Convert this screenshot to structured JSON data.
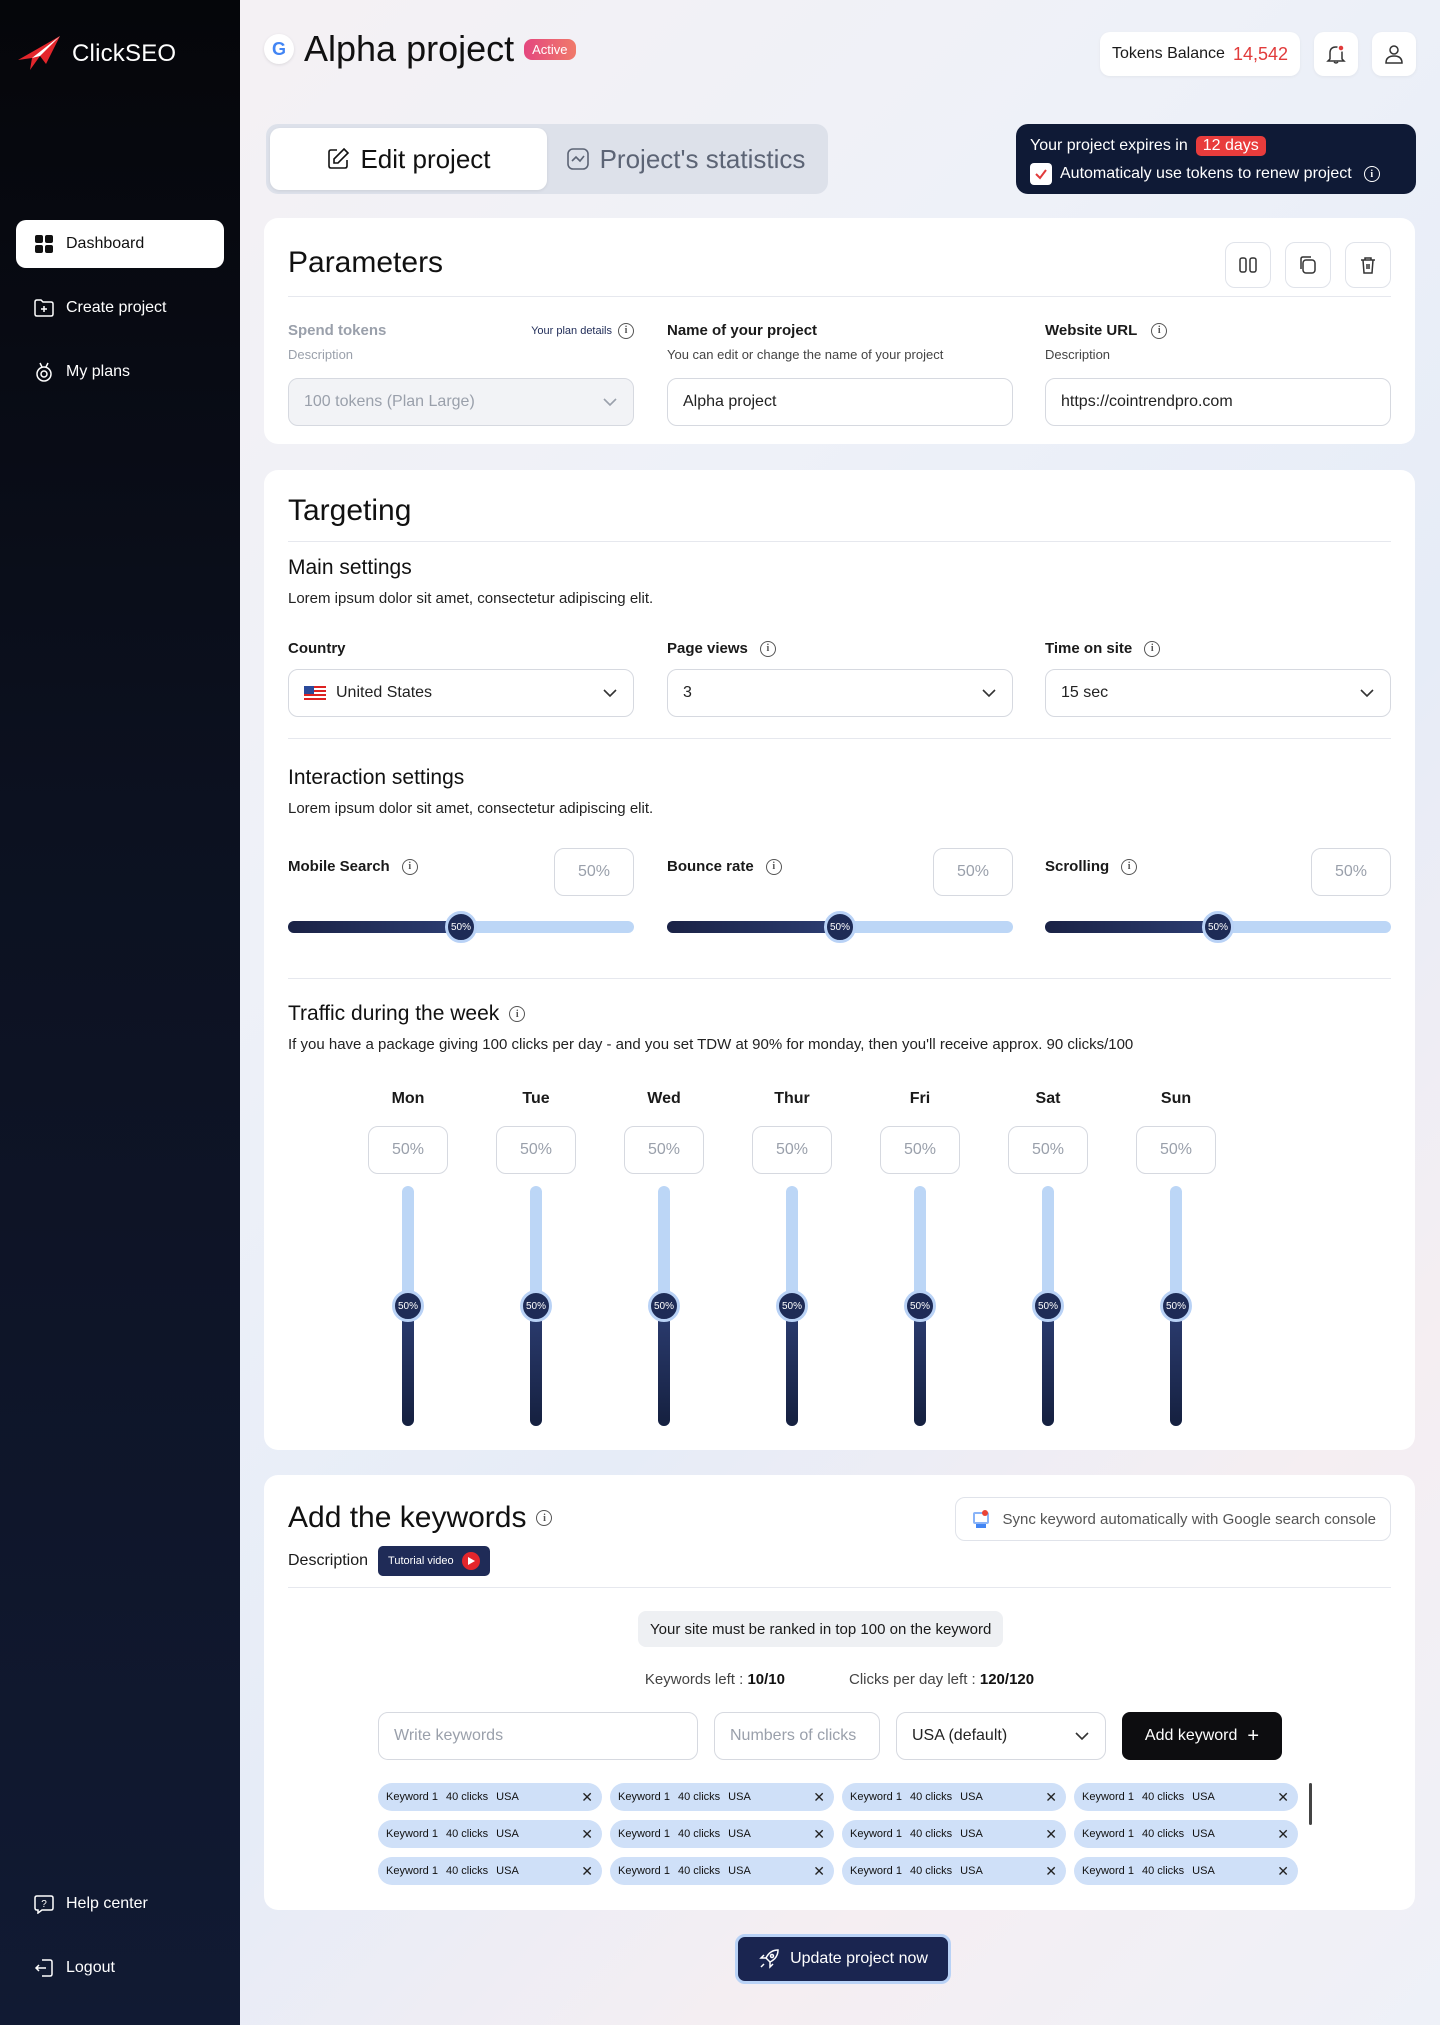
{
  "brand": {
    "name": "ClickSEO"
  },
  "sidebar": {
    "items": [
      {
        "label": "Dashboard",
        "icon": "grid-icon",
        "active": true
      },
      {
        "label": "Create project",
        "icon": "folder-plus-icon"
      },
      {
        "label": "My plans",
        "icon": "plans-icon"
      }
    ],
    "bottom": [
      {
        "label": "Help center",
        "icon": "help-icon"
      },
      {
        "label": "Logout",
        "icon": "logout-icon"
      }
    ]
  },
  "header": {
    "project_title": "Alpha project",
    "status": "Active",
    "tokens_label": "Tokens Balance",
    "tokens_value": "14,542"
  },
  "tabs": [
    {
      "label": "Edit project",
      "active": true
    },
    {
      "label": "Project's statistics"
    }
  ],
  "expiry": {
    "prefix": "Your project expires in",
    "days": "12 days",
    "auto_renew_label": "Automaticaly use tokens to renew project",
    "auto_renew_checked": true
  },
  "parameters": {
    "title": "Parameters",
    "spend": {
      "label": "Spend tokens",
      "desc": "Description",
      "plan_link": "Your plan details",
      "value": "100 tokens (Plan Large)"
    },
    "name": {
      "label": "Name of your project",
      "desc": "You can edit or change the name of your project",
      "value": "Alpha project"
    },
    "url": {
      "label": "Website URL",
      "desc": "Description",
      "value": "https://cointrendpro.com"
    }
  },
  "targeting": {
    "title": "Targeting",
    "main": {
      "title": "Main settings",
      "desc": "Lorem ipsum dolor sit amet, consectetur adipiscing elit."
    },
    "country": {
      "label": "Country",
      "value": "United States"
    },
    "page_views": {
      "label": "Page views",
      "value": "3"
    },
    "time_on_site": {
      "label": "Time on site",
      "value": "15 sec"
    },
    "interaction": {
      "title": "Interaction settings",
      "desc": "Lorem ipsum dolor sit amet, consectetur adipiscing elit."
    },
    "sliders": [
      {
        "label": "Mobile Search",
        "value": "50%",
        "fraction": 0.5
      },
      {
        "label": "Bounce rate",
        "value": "50%",
        "fraction": 0.5
      },
      {
        "label": "Scrolling",
        "value": "50%",
        "fraction": 0.5
      }
    ],
    "traffic": {
      "title": "Traffic during the week",
      "desc": "If you have a package giving 100 clicks per day - and you set TDW at 90% for monday, then you'll receive approx. 90 clicks/100"
    },
    "days": [
      {
        "day": "Mon",
        "value": "50%",
        "fraction": 0.5
      },
      {
        "day": "Tue",
        "value": "50%",
        "fraction": 0.5
      },
      {
        "day": "Wed",
        "value": "50%",
        "fraction": 0.5
      },
      {
        "day": "Thur",
        "value": "50%",
        "fraction": 0.5
      },
      {
        "day": "Fri",
        "value": "50%",
        "fraction": 0.5
      },
      {
        "day": "Sat",
        "value": "50%",
        "fraction": 0.5
      },
      {
        "day": "Sun",
        "value": "50%",
        "fraction": 0.5
      }
    ]
  },
  "keywords": {
    "title": "Add the keywords",
    "desc": "Description",
    "tutorial": "Tutorial video",
    "sync": "Sync keyword automatically with Google search console",
    "notice": "Your site must be ranked in top 100 on the keyword",
    "left_label": "Keywords left :",
    "left_value": "10/10",
    "clicks_label": "Clicks per day left :",
    "clicks_value": "120/120",
    "input_placeholder": "Write keywords",
    "clicks_placeholder": "Numbers of clicks",
    "country_value": "USA (default)",
    "add_label": "Add keyword",
    "chips": [
      {
        "kw": "Keyword 1",
        "clicks": "40 clicks",
        "country": "USA"
      },
      {
        "kw": "Keyword 1",
        "clicks": "40 clicks",
        "country": "USA"
      },
      {
        "kw": "Keyword 1",
        "clicks": "40 clicks",
        "country": "USA"
      },
      {
        "kw": "Keyword 1",
        "clicks": "40 clicks",
        "country": "USA"
      },
      {
        "kw": "Keyword 1",
        "clicks": "40 clicks",
        "country": "USA"
      },
      {
        "kw": "Keyword 1",
        "clicks": "40 clicks",
        "country": "USA"
      },
      {
        "kw": "Keyword 1",
        "clicks": "40 clicks",
        "country": "USA"
      },
      {
        "kw": "Keyword 1",
        "clicks": "40 clicks",
        "country": "USA"
      },
      {
        "kw": "Keyword 1",
        "clicks": "40 clicks",
        "country": "USA"
      },
      {
        "kw": "Keyword 1",
        "clicks": "40 clicks",
        "country": "USA"
      },
      {
        "kw": "Keyword 1",
        "clicks": "40 clicks",
        "country": "USA"
      },
      {
        "kw": "Keyword 1",
        "clicks": "40 clicks",
        "country": "USA"
      }
    ]
  },
  "update_button": "Update project now",
  "colors": {
    "accent_red": "#e13b3b",
    "navy": "#0f1a36",
    "slider_light": "#bcd6f6",
    "slider_dark": "#1e2b56"
  }
}
